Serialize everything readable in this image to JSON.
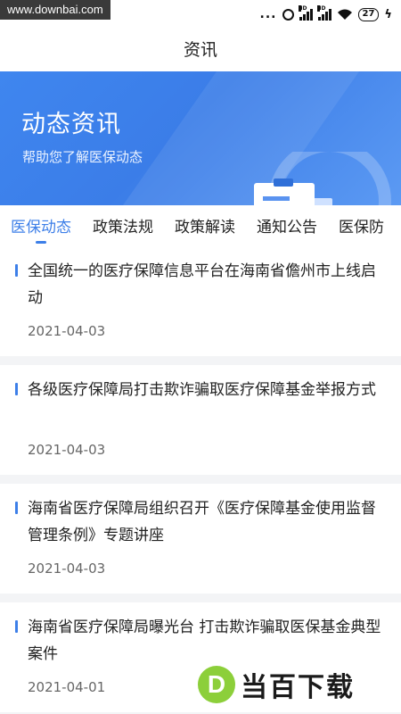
{
  "statusbar": {
    "watermark": "www.downbai.com",
    "dots": "...",
    "battery": "27",
    "signal_label": "HD"
  },
  "header": {
    "title": "资讯"
  },
  "banner": {
    "title": "动态资讯",
    "subtitle": "帮助您了解医保动态",
    "background_color": "#3f86ef"
  },
  "tabs": [
    {
      "label": "医保动态",
      "active": true
    },
    {
      "label": "政策法规",
      "active": false
    },
    {
      "label": "政策解读",
      "active": false
    },
    {
      "label": "通知公告",
      "active": false
    },
    {
      "label": "医保防",
      "active": false
    }
  ],
  "news": [
    {
      "title": "全国统一的医疗保障信息平台在海南省儋州市上线启动",
      "date": "2021-04-03"
    },
    {
      "title": "各级医疗保障局打击欺诈骗取医疗保障基金举报方式",
      "date": "2021-04-03"
    },
    {
      "title": "海南省医疗保障局组织召开《医疗保障基金使用监督管理条例》专题讲座",
      "date": "2021-04-03"
    },
    {
      "title": "海南省医疗保障局曝光台  打击欺诈骗取医保基金典型案件",
      "date": "2021-04-01"
    }
  ],
  "brand": {
    "logo_letter": "D",
    "text": "当百下载"
  },
  "colors": {
    "accent": "#3d7fe8",
    "divider": "#f3f4f6"
  }
}
